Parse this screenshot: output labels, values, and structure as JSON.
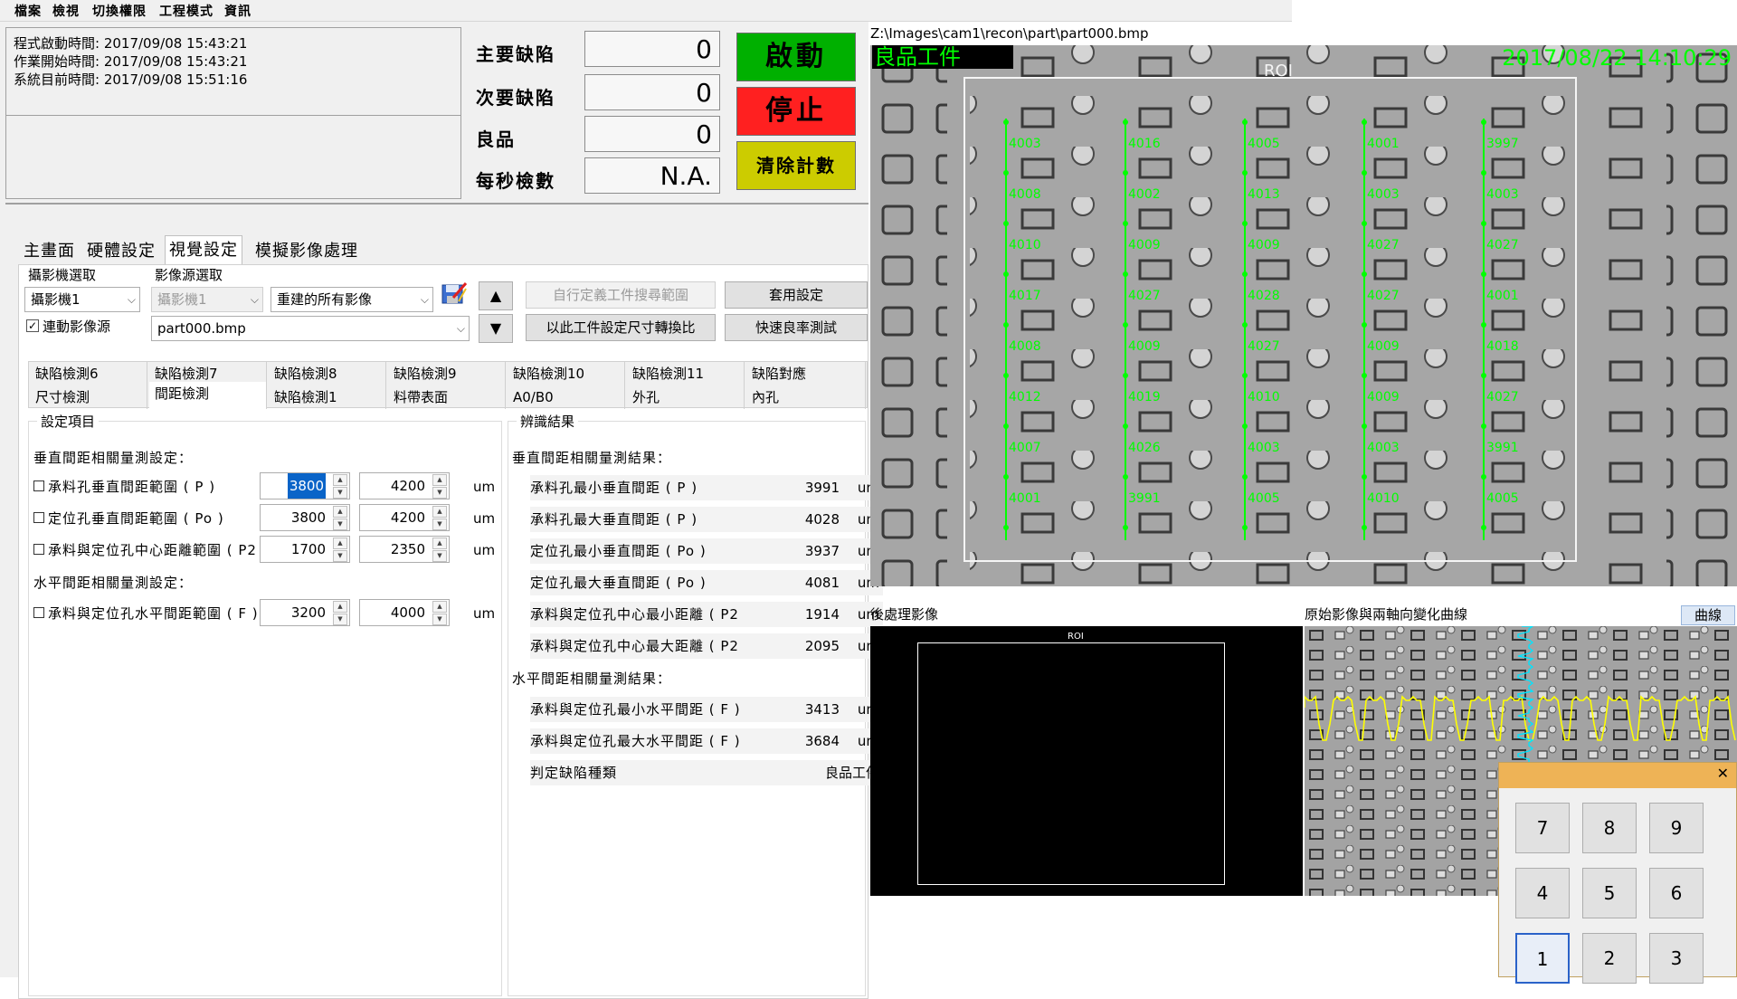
{
  "menu": [
    "檔案",
    "檢視",
    "切換權限",
    "工程模式",
    "資訊"
  ],
  "info": {
    "lines": [
      "程式啟動時間: 2017/09/08 15:43:21",
      "作業開始時間: 2017/09/08 15:43:21",
      "系統目前時間: 2017/09/08 15:51:16"
    ]
  },
  "counters": [
    {
      "label": "主要缺陷",
      "value": "0"
    },
    {
      "label": "次要缺陷",
      "value": "0"
    },
    {
      "label": "良品",
      "value": "0"
    },
    {
      "label": "每秒檢數",
      "value": "N.A."
    }
  ],
  "buttons": {
    "start": "啟動",
    "stop": "停止",
    "clear": "清除計數"
  },
  "colors": {
    "start": "#00b000",
    "stop": "#ff2020",
    "clear": "#cccc00",
    "overlay_green": "#00ff00",
    "curve_yellow": "#ffff00",
    "curve_cyan": "#00e5ff"
  },
  "tabs": [
    "主畫面",
    "硬體設定",
    "視覺設定",
    "模擬影像處理"
  ],
  "camera": {
    "group_label": "攝影機選取",
    "selected": "攝影機1",
    "link_label": "連動影像源",
    "link_checked": true
  },
  "source": {
    "group_label": "影像源選取",
    "camera": "攝影機1",
    "mode": "重建的所有影像",
    "file": "part000.bmp"
  },
  "tool_buttons": {
    "custom_roi": "自行定義工件搜尋範圍",
    "apply": "套用設定",
    "set_ratio": "以此工件設定尺寸轉換比",
    "quick_test": "快速良率測試"
  },
  "icons": {
    "save": "save-icon",
    "up": "▲",
    "down": "▼",
    "close": "✕"
  },
  "subtabs_row1": [
    "缺陷檢測6",
    "缺陷檢測7",
    "缺陷檢測8",
    "缺陷檢測9",
    "缺陷檢測10",
    "缺陷檢測11",
    "缺陷對應"
  ],
  "subtabs_row2": [
    "尺寸檢測",
    "間距檢測",
    "缺陷檢測1",
    "料帶表面",
    "A0/B0",
    "外孔",
    "內孔"
  ],
  "settings": {
    "title": "設定項目",
    "vertical_header": "垂直間距相關量測設定：",
    "horizontal_header": "水平間距相關量測設定：",
    "rows": [
      {
        "label": "承料孔垂直間距範圍 ( P )",
        "min": "3800",
        "max": "4200",
        "unit": "um"
      },
      {
        "label": "定位孔垂直間距範圍 ( Po )",
        "min": "3800",
        "max": "4200",
        "unit": "um"
      },
      {
        "label": "承料與定位孔中心距離範圍 ( P2",
        "min": "1700",
        "max": "2350",
        "unit": "um"
      },
      {
        "label": "承料與定位孔水平間距範圍 ( F )",
        "min": "3200",
        "max": "4000",
        "unit": "um"
      }
    ]
  },
  "results": {
    "title": "辨識結果",
    "vertical_header": "垂直間距相關量測結果：",
    "horizontal_header": "水平間距相關量測結果：",
    "rows": [
      {
        "label": "承料孔最小垂直間距 ( P )",
        "value": "3991",
        "unit": "um"
      },
      {
        "label": "承料孔最大垂直間距 ( P )",
        "value": "4028",
        "unit": "um"
      },
      {
        "label": "定位孔最小垂直間距 ( Po )",
        "value": "3937",
        "unit": "um"
      },
      {
        "label": "定位孔最大垂直間距 ( Po )",
        "value": "4081",
        "unit": "um"
      },
      {
        "label": "承料與定位孔中心最小距離 ( P2",
        "value": "1914",
        "unit": "um"
      },
      {
        "label": "承料與定位孔中心最大距離 ( P2",
        "value": "2095",
        "unit": "um"
      },
      {
        "label": "承料與定位孔最小水平間距 ( F )",
        "value": "3413",
        "unit": "um"
      },
      {
        "label": "承料與定位孔最大水平間距 ( F )",
        "value": "3684",
        "unit": "um"
      }
    ],
    "defect_label": "判定缺陷種類",
    "defect_value": "良品工件"
  },
  "image": {
    "path": "Z:\\Images\\cam1\\recon\\part\\part000.bmp",
    "status": "良品工件",
    "timestamp": "2017/08/22 14:10:29",
    "roi_label": "ROI",
    "columns": [
      [
        "4003",
        "4008",
        "4010",
        "4017",
        "4008",
        "4012",
        "4007",
        "4001"
      ],
      [
        "4016",
        "4002",
        "4009",
        "4027",
        "4009",
        "4019",
        "4026",
        "3991"
      ],
      [
        "4005",
        "4013",
        "4009",
        "4028",
        "4027",
        "4010",
        "4003",
        "4005"
      ],
      [
        "4001",
        "4003",
        "4027",
        "4027",
        "4009",
        "4009",
        "4003",
        "4010"
      ],
      [
        "3997",
        "4003",
        "4027",
        "4001",
        "4018",
        "4027",
        "3991",
        "4005"
      ]
    ]
  },
  "panels": {
    "post_label": "後處理影像",
    "orig_label": "原始影像與兩軸向變化曲線",
    "curve_button": "曲線",
    "post_roi": "ROI"
  },
  "keypad": [
    "7",
    "8",
    "9",
    "4",
    "5",
    "6",
    "1",
    "2",
    "3"
  ]
}
